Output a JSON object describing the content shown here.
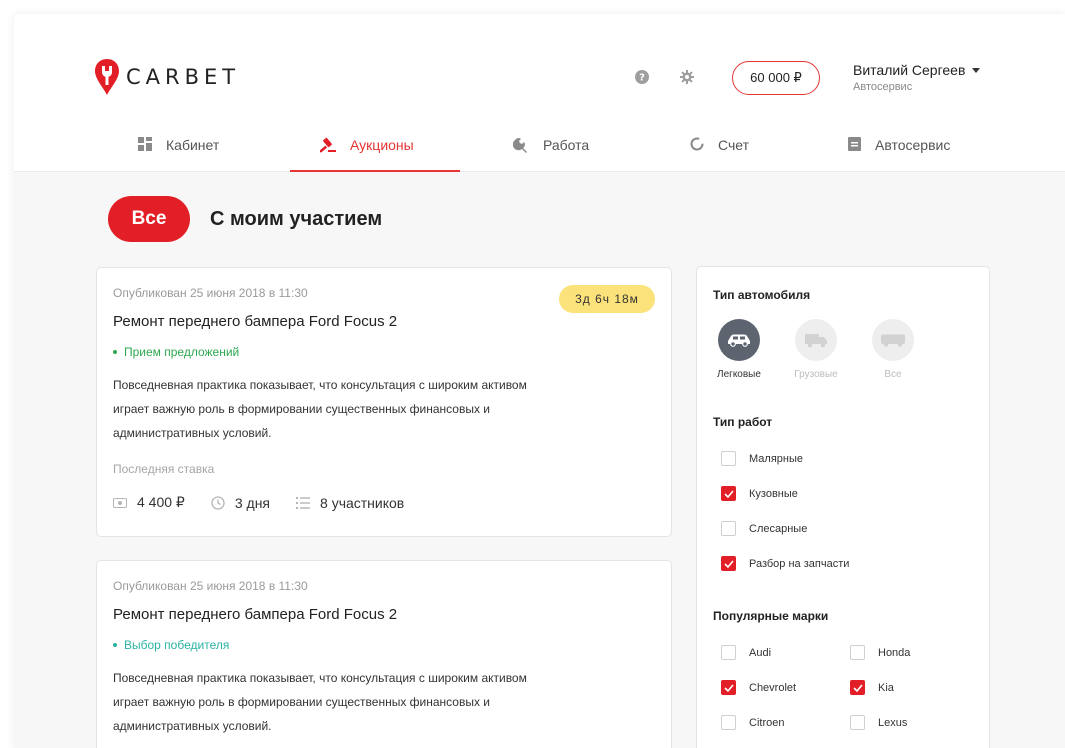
{
  "app": {
    "logo_text": "CARBET"
  },
  "header": {
    "balance": "60 000 ₽",
    "user_name": "Виталий Сергеев",
    "user_role": "Автосервис"
  },
  "nav": [
    {
      "label": "Кабинет",
      "icon": "dashboard-icon",
      "active": false
    },
    {
      "label": "Аукционы",
      "icon": "gavel-icon",
      "active": true
    },
    {
      "label": "Работа",
      "icon": "wrench-icon",
      "active": false
    },
    {
      "label": "Счет",
      "icon": "circle-icon",
      "active": false
    },
    {
      "label": "Автосервис",
      "icon": "document-icon",
      "active": false
    }
  ],
  "tabs": {
    "all": "Все",
    "mine": "С моим участием"
  },
  "auctions": [
    {
      "published": "Опубликован 25 июня 2018 в 11:30",
      "title": "Ремонт переднего бампера Ford Focus 2",
      "status": "Прием предложений",
      "status_color": "#2fa84f",
      "description": [
        "Повседневная практика показывает, что консультация с широким активом",
        "играет важную роль в формировании существенных финансовых и",
        "административных условий."
      ],
      "last_bid_label": "Последняя ставка",
      "price": "4 400 ₽",
      "duration": "3 дня",
      "participants": "8 участников",
      "timer": "3д 6ч 18м"
    },
    {
      "published": "Опубликован 25 июня 2018 в 11:30",
      "title": "Ремонт переднего бампера Ford Focus 2",
      "status": "Выбор победителя",
      "status_color": "#2bb3a3",
      "description": [
        "Повседневная практика показывает, что консультация с широким активом",
        "играет важную роль в формировании существенных финансовых и",
        "административных условий."
      ]
    }
  ],
  "filters": {
    "vehicle_type": {
      "title": "Тип автомобиля",
      "options": [
        {
          "label": "Легковые",
          "icon": "car-icon",
          "selected": true
        },
        {
          "label": "Грузовые",
          "icon": "truck-icon",
          "selected": false
        },
        {
          "label": "Все",
          "icon": "bus-icon",
          "selected": false
        }
      ]
    },
    "work_type": {
      "title": "Тип работ",
      "options": [
        {
          "label": "Малярные",
          "checked": false
        },
        {
          "label": "Кузовные",
          "checked": true
        },
        {
          "label": "Слесарные",
          "checked": false
        },
        {
          "label": "Разбор на запчасти",
          "checked": true
        }
      ]
    },
    "brands": {
      "title": "Популярные марки",
      "options": [
        {
          "label": "Audi",
          "checked": false
        },
        {
          "label": "Honda",
          "checked": false
        },
        {
          "label": "Chevrolet",
          "checked": true
        },
        {
          "label": "Kia",
          "checked": true
        },
        {
          "label": "Citroen",
          "checked": false
        },
        {
          "label": "Lexus",
          "checked": false
        }
      ]
    }
  },
  "colors": {
    "accent": "#e21e26",
    "timer_bg": "#fbe27a",
    "page_bg": "#f7f7f7"
  }
}
